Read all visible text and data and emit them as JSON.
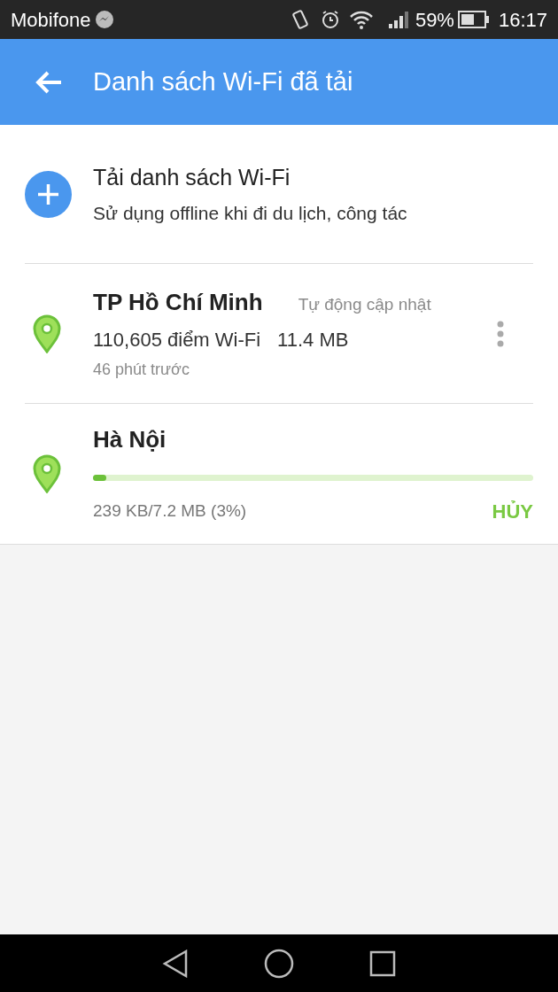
{
  "status_bar": {
    "carrier": "Mobifone",
    "battery_percent": "59%",
    "time": "16:17"
  },
  "app_bar": {
    "title": "Danh sách Wi-Fi đã tải"
  },
  "add_item": {
    "title": "Tải danh sách Wi-Fi",
    "subtitle": "Sử dụng offline khi đi du lịch, công tác"
  },
  "cities": [
    {
      "kind": "downloaded",
      "name": "TP Hồ Chí Minh",
      "badge": "Tự động cập nhật",
      "points": "110,605 điểm Wi-Fi",
      "size": "11.4 MB",
      "updated": "46 phút trước"
    },
    {
      "kind": "downloading",
      "name": "Hà Nội",
      "level": 0.03,
      "progress_text": "239 KB/7.2 MB (3%)",
      "cancel": "HỦY"
    }
  ]
}
